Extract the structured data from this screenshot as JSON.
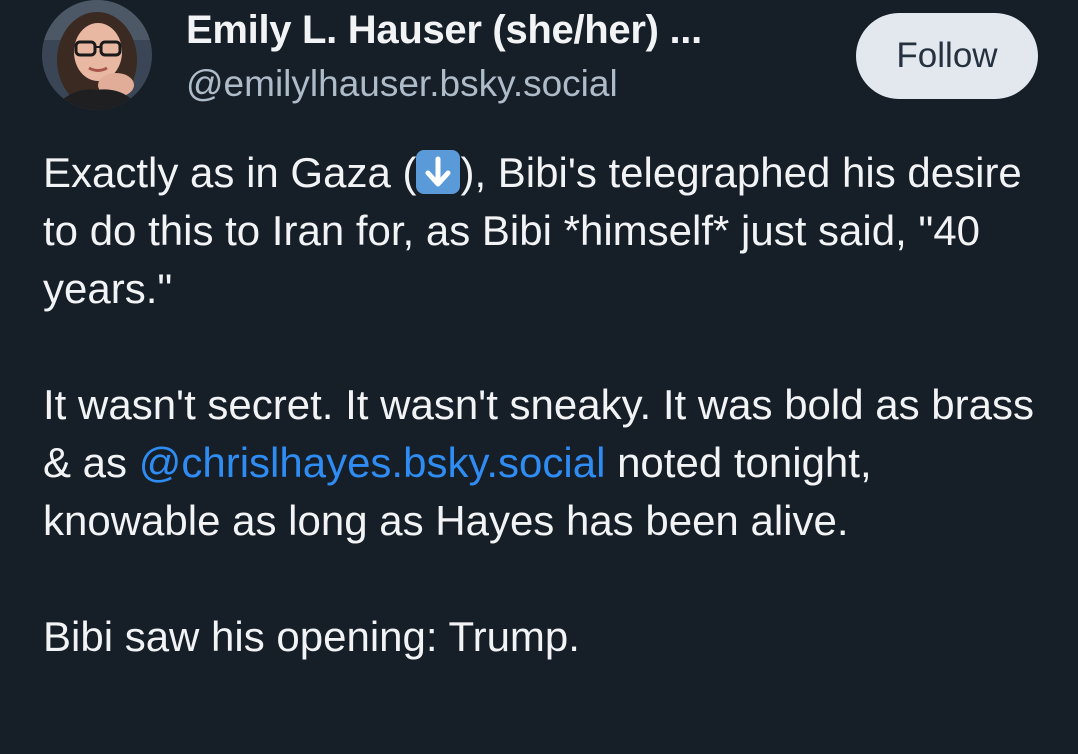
{
  "author": {
    "display_name": "Emily L. Hauser (she/her) ...",
    "handle": "@emilylhauser.bsky.social"
  },
  "actions": {
    "follow_label": "Follow"
  },
  "post": {
    "p1_before_emoji": "Exactly as in Gaza (",
    "p1_emoji": "down-arrow-emoji",
    "p1_after_emoji": "), Bibi's telegraphed his desire to do this to Iran for, as Bibi *himself* just said, \"40 years.\"",
    "p2_before_mention": "It wasn't secret. It wasn't sneaky. It was bold as brass & as ",
    "p2_mention": "@chrislhayes.bsky.social",
    "p2_after_mention": " noted tonight, knowable as long as Hayes has been alive.",
    "p3": "Bibi saw his opening: Trump."
  },
  "colors": {
    "background": "#161e27",
    "text": "#f1f3f5",
    "handle": "#aebbc9",
    "link": "#2f8cf2",
    "follow_bg": "#e3e8ee"
  }
}
